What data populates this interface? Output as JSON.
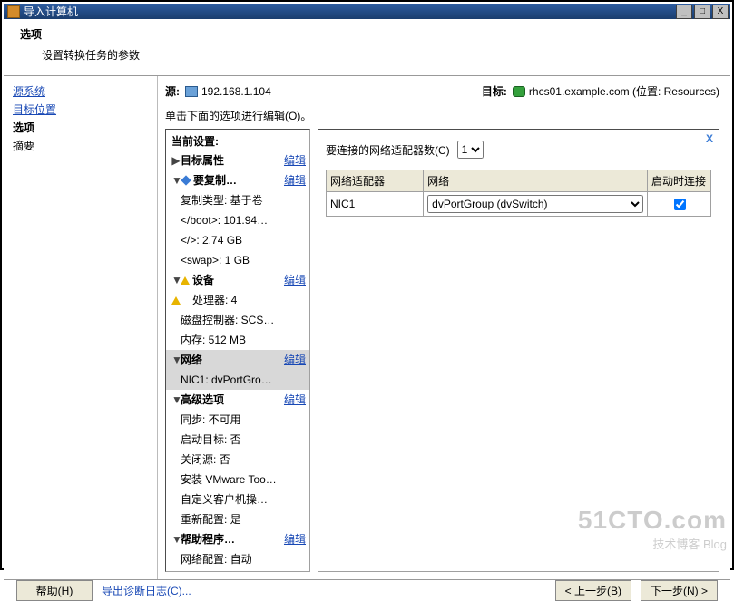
{
  "window": {
    "title": "导入计算机",
    "min": "_",
    "max": "□",
    "close": "X"
  },
  "header": {
    "title": "选项",
    "subtitle": "设置转换任务的参数"
  },
  "nav": {
    "src": "源系统",
    "dst": "目标位置",
    "opts": "选项",
    "summary": "摘要"
  },
  "srcdst": {
    "src_label": "源:",
    "src_value": "192.168.1.104",
    "dst_label": "目标:",
    "dst_value": "rhcs01.example.com (位置: Resources)"
  },
  "hint": "单击下面的选项进行编辑(O)。",
  "tree": {
    "current": "当前设置:",
    "edit": "编辑",
    "target_attrs": "目标属性",
    "to_copy": "要复制…",
    "copy_type": "复制类型: 基于卷",
    "boot": "</boot>: 101.94…",
    "root": "</>: 2.74 GB",
    "swap": "<swap>: 1 GB",
    "devices": "设备",
    "cpu": "处理器: 4",
    "disk": "磁盘控制器: SCS…",
    "mem": "内存: 512 MB",
    "network": "网络",
    "nic1": "NIC1: dvPortGro…",
    "advanced": "高级选项",
    "sync": "同步: 不可用",
    "boot_tgt": "启动目标: 否",
    "poweroff": "关闭源: 否",
    "vmtools": "安装 VMware Too…",
    "guest_cust": "自定义客户机操…",
    "reconfig": "重新配置: 是",
    "helper": "帮助程序…",
    "netcfg": "网络配置: 自动"
  },
  "detail": {
    "nic_count_label": "要连接的网络适配器数(C)",
    "nic_count_value": "1",
    "col_adapter": "网络适配器",
    "col_network": "网络",
    "col_connect": "启动时连接",
    "row_nic": "NIC1",
    "row_net": "dvPortGroup (dvSwitch)",
    "close_x": "X"
  },
  "footer": {
    "help": "帮助(H)",
    "export": "导出诊断日志(C)...",
    "back": "< 上一步(B)",
    "next": "下一步(N) >",
    "cancel_hidden": ""
  },
  "watermark": {
    "big": "51CTO.com",
    "sm": "技术博客  Blog"
  }
}
